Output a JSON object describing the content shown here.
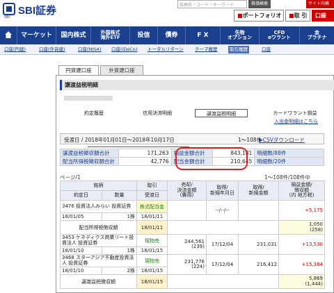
{
  "header": {
    "logo_sub": "SBI",
    "logo_text": "SBI証券",
    "search_placeholder": "銘柄名・コード・キーワード",
    "search_button": "株価検索",
    "top_link": "サイト内検",
    "portfolio_button": "ポートフォリオ",
    "trade_button": "取 引",
    "account_button": "口座"
  },
  "nav": {
    "items": [
      "マーケット",
      "国内株式",
      "外国株式\n海外ETF",
      "投信",
      "債券",
      "F X",
      "先物\nオプション",
      "CFD\neワラント",
      "金\nプラチナ"
    ]
  },
  "subnav": {
    "items": [
      "口座(円建)",
      "口座(外貨建)",
      "口座(NISA)",
      "口座(iDeCo)",
      "トータルリターン",
      "テーマ履歴",
      "取引履歴",
      "口座"
    ]
  },
  "tabs": [
    "円貨建口座",
    "外貨建口座"
  ],
  "section_title": "譲渡益税明細",
  "filter_tabs": [
    "約定履歴",
    "信用決済明細",
    "譲渡益税明細",
    "カードワラント損益"
  ],
  "warrant_link": "入出金明細はこちら",
  "period": {
    "label": "受渡日",
    "value": "2018年01月01日〜2018年10月17日",
    "count": "1〜108件",
    "csv": "CSVダウンロード"
  },
  "summary": {
    "rows": [
      {
        "l1": "譲渡益税徴収額合計",
        "v1": "171,263",
        "l2": "損益金額合計",
        "v2": "843,181",
        "l3": "明細数/88件"
      },
      {
        "l1": "配当所得税徴収額合計",
        "v1": "42,776",
        "l2": "配当金額合計",
        "v2": "210,645",
        "l3": "明細数/20件"
      }
    ]
  },
  "page": {
    "label": "ページ/1",
    "range": "1〜108件/108件中"
  },
  "table": {
    "headers": {
      "meigara": "銘柄",
      "torihiki": "取引",
      "baikyaku": "売却/\n決済金額\n(費用)",
      "shutoku_date": "取得/\n新規年月日",
      "shutoku_price": "取得/\n新規金額",
      "soneki": "損益金額/\n徴収額\n(内 地方税)",
      "yakujo": "約定日",
      "suryo": "数量",
      "ukewatashi": "受渡日"
    },
    "rows": [
      {
        "name": "3476 投資法人みらい 投資証券",
        "date1": "18/01/05",
        "qty": "1株",
        "type": "株式配当金",
        "date2": "18/01/11",
        "sale": "",
        "acq_date": "--/--/--",
        "acq_price": "",
        "pl": "+5,175",
        "tax": "",
        "kind": "dividend"
      },
      {
        "name": "配当所得税徴収額",
        "type": "18/01/11",
        "pl": "1,050",
        "tax": "(258)",
        "kind": "taxrow"
      },
      {
        "name": "3453 ケネディクス商業リート投資法人 投資証券",
        "date1": "18/01/10",
        "qty": "1株",
        "type": "現物売",
        "date2": "18/01/15",
        "sale": "244,561",
        "fee": "(239)",
        "acq_date": "17/12/04",
        "acq_price": "231,031",
        "pl": "+13,530",
        "kind": "sell"
      },
      {
        "name": "3468 スターアジア不動産投資法人 投資証券",
        "date1": "18/01/10",
        "qty": "2株",
        "type": "現物売",
        "date2": "18/01/15",
        "sale": "231,776",
        "fee": "(224)",
        "acq_date": "17/12/04",
        "acq_price": "216,412",
        "pl": "+15,364",
        "kind": "sell"
      },
      {
        "name": "譲渡益税徴収額",
        "type": "18/01/15",
        "pl": "5,869",
        "tax": "(1,444)",
        "kind": "taxrow"
      }
    ]
  },
  "colors": {
    "nav_bg": "#1b3f8f",
    "accent_red": "#d00000",
    "green": "#1e7a1e"
  }
}
